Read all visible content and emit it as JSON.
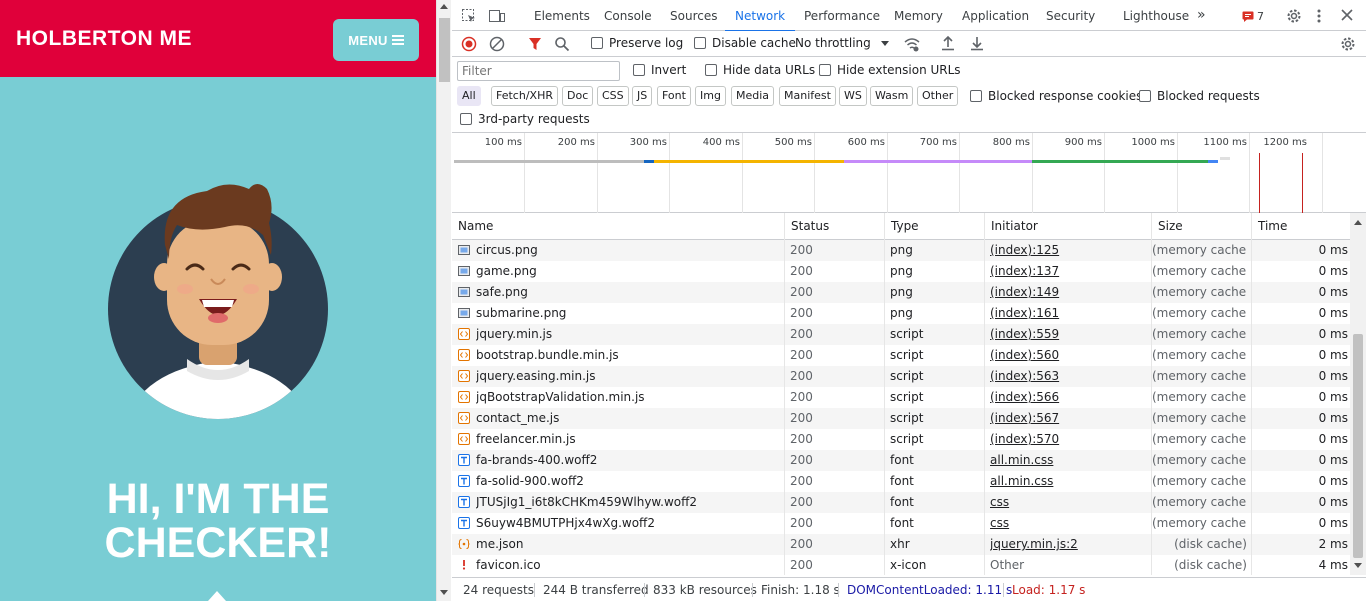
{
  "page": {
    "brand": "HOLBERTON ME",
    "menu_label": "MENU",
    "hero_title_line1": "HI, I'M THE",
    "hero_title_line2": "CHECKER!",
    "colors": {
      "navbar": "#e0003a",
      "background": "#79cdd4",
      "avatar_circle": "#2c3e50"
    }
  },
  "devtools": {
    "tabs": [
      "Elements",
      "Console",
      "Sources",
      "Network",
      "Performance",
      "Memory",
      "Application",
      "Security",
      "Lighthouse"
    ],
    "active_tab": "Network",
    "issues_count": "7",
    "toolbar": {
      "preserve_log": "Preserve log",
      "disable_cache": "Disable cache",
      "throttling": "No throttling"
    },
    "filterbar": {
      "filter_placeholder": "Filter",
      "invert": "Invert",
      "hide_data_urls": "Hide data URLs",
      "hide_extension_urls": "Hide extension URLs",
      "types": [
        "All",
        "Fetch/XHR",
        "Doc",
        "CSS",
        "JS",
        "Font",
        "Img",
        "Media",
        "Manifest",
        "WS",
        "Wasm",
        "Other"
      ],
      "blocked_response_cookies": "Blocked response cookies",
      "blocked_requests": "Blocked requests",
      "third_party": "3rd-party requests"
    },
    "timeline_ticks": [
      "100 ms",
      "200 ms",
      "300 ms",
      "400 ms",
      "500 ms",
      "600 ms",
      "700 ms",
      "800 ms",
      "900 ms",
      "1000 ms",
      "1100 ms",
      "1200 ms"
    ],
    "columns": [
      "Name",
      "Status",
      "Type",
      "Initiator",
      "Size",
      "Time"
    ],
    "requests": [
      {
        "name": "circus.png",
        "status": "200",
        "type": "png",
        "initiator": "(index):125",
        "size": "(memory cache)",
        "time": "0 ms",
        "icon": "image-icon"
      },
      {
        "name": "game.png",
        "status": "200",
        "type": "png",
        "initiator": "(index):137",
        "size": "(memory cache)",
        "time": "0 ms",
        "icon": "image-icon"
      },
      {
        "name": "safe.png",
        "status": "200",
        "type": "png",
        "initiator": "(index):149",
        "size": "(memory cache)",
        "time": "0 ms",
        "icon": "image-icon"
      },
      {
        "name": "submarine.png",
        "status": "200",
        "type": "png",
        "initiator": "(index):161",
        "size": "(memory cache)",
        "time": "0 ms",
        "icon": "image-icon"
      },
      {
        "name": "jquery.min.js",
        "status": "200",
        "type": "script",
        "initiator": "(index):559",
        "size": "(memory cache)",
        "time": "0 ms",
        "icon": "script-icon"
      },
      {
        "name": "bootstrap.bundle.min.js",
        "status": "200",
        "type": "script",
        "initiator": "(index):560",
        "size": "(memory cache)",
        "time": "0 ms",
        "icon": "script-icon"
      },
      {
        "name": "jquery.easing.min.js",
        "status": "200",
        "type": "script",
        "initiator": "(index):563",
        "size": "(memory cache)",
        "time": "0 ms",
        "icon": "script-icon"
      },
      {
        "name": "jqBootstrapValidation.min.js",
        "status": "200",
        "type": "script",
        "initiator": "(index):566",
        "size": "(memory cache)",
        "time": "0 ms",
        "icon": "script-icon"
      },
      {
        "name": "contact_me.js",
        "status": "200",
        "type": "script",
        "initiator": "(index):567",
        "size": "(memory cache)",
        "time": "0 ms",
        "icon": "script-icon"
      },
      {
        "name": "freelancer.min.js",
        "status": "200",
        "type": "script",
        "initiator": "(index):570",
        "size": "(memory cache)",
        "time": "0 ms",
        "icon": "script-icon"
      },
      {
        "name": "fa-brands-400.woff2",
        "status": "200",
        "type": "font",
        "initiator": "all.min.css",
        "size": "(memory cache)",
        "time": "0 ms",
        "icon": "font-icon"
      },
      {
        "name": "fa-solid-900.woff2",
        "status": "200",
        "type": "font",
        "initiator": "all.min.css",
        "size": "(memory cache)",
        "time": "0 ms",
        "icon": "font-icon"
      },
      {
        "name": "JTUSjIg1_i6t8kCHKm459Wlhyw.woff2",
        "status": "200",
        "type": "font",
        "initiator": "css",
        "size": "(memory cache)",
        "time": "0 ms",
        "icon": "font-icon"
      },
      {
        "name": "S6uyw4BMUTPHjx4wXg.woff2",
        "status": "200",
        "type": "font",
        "initiator": "css",
        "size": "(memory cache)",
        "time": "0 ms",
        "icon": "font-icon"
      },
      {
        "name": "me.json",
        "status": "200",
        "type": "xhr",
        "initiator": "jquery.min.js:2",
        "size": "(disk cache)",
        "time": "2 ms",
        "icon": "xhr-icon"
      },
      {
        "name": "favicon.ico",
        "status": "200",
        "type": "x-icon",
        "initiator": "Other",
        "size": "(disk cache)",
        "time": "4 ms",
        "icon": "favicon-icon"
      }
    ],
    "status_bar": {
      "requests": "24 requests",
      "transferred": "244 B transferred",
      "resources": "833 kB resources",
      "finish": "Finish: 1.18 s",
      "dom_content_loaded": "DOMContentLoaded: 1.11 s",
      "load": "Load: 1.17 s",
      "dcl_color": "#1a1aa6",
      "load_color": "#c5221f"
    }
  }
}
